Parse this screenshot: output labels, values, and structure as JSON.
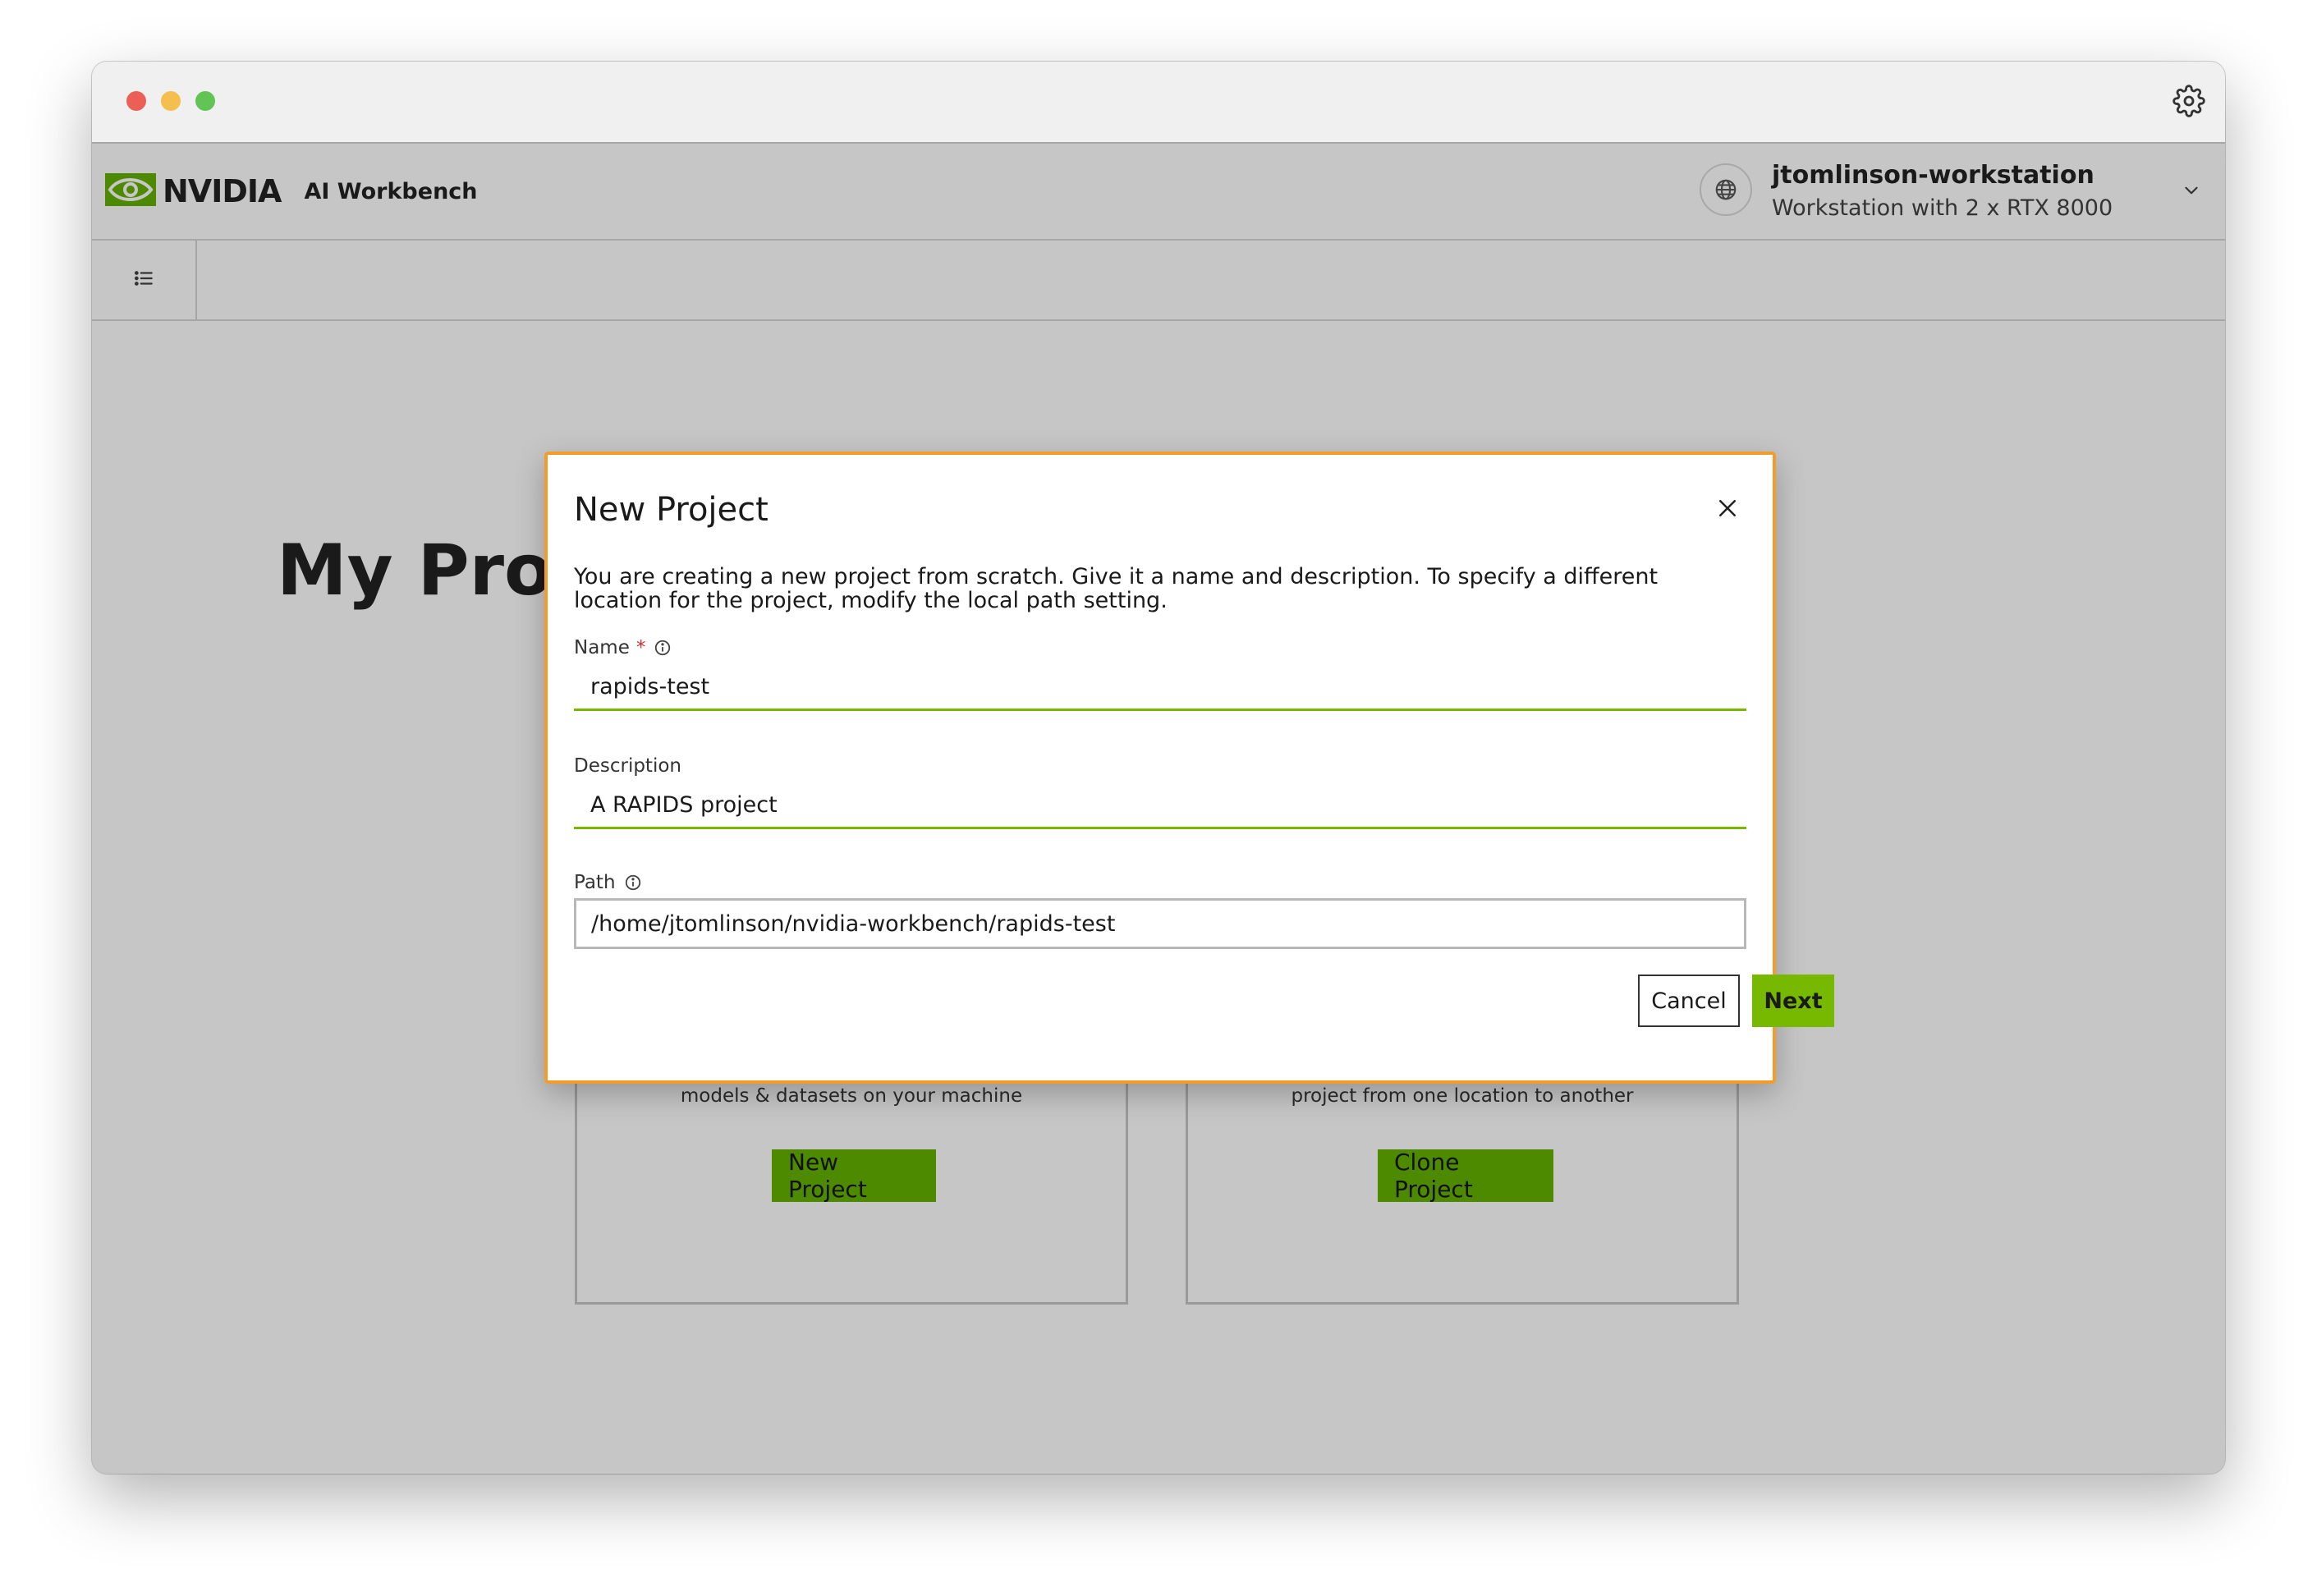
{
  "window": {
    "traffic_lights": {
      "close": "#ec5f57",
      "minimize": "#f4bf4f",
      "zoom": "#61c454"
    }
  },
  "header": {
    "brand": "NVIDIA",
    "app_name": "AI Workbench",
    "location": {
      "name": "jtomlinson-workstation",
      "description": "Workstation with 2 x RTX 8000"
    }
  },
  "page": {
    "title": "My Proj",
    "cards": [
      {
        "text": "models & datasets on your machine",
        "button": "New Project"
      },
      {
        "text": "project from one location to another",
        "button": "Clone Project"
      }
    ]
  },
  "dialog": {
    "title": "New Project",
    "description": "You are creating a new project from scratch. Give it a name and description. To specify a different location for the project, modify the local path setting.",
    "fields": {
      "name": {
        "label": "Name",
        "required": "*",
        "value": "rapids-test"
      },
      "description": {
        "label": "Description",
        "value": "A RAPIDS project"
      },
      "path": {
        "label": "Path",
        "value": "/home/jtomlinson/nvidia-workbench/rapids-test"
      }
    },
    "buttons": {
      "cancel": "Cancel",
      "next": "Next"
    }
  },
  "colors": {
    "accent": "#76b900",
    "button_dark": "#4e8a00",
    "focus_border": "#f39c2a",
    "required": "#d32f2f",
    "backdrop": "#c6c6c6"
  },
  "icons": [
    "settings-gear-icon",
    "nvidia-logo-icon",
    "globe-icon",
    "chevron-down-icon",
    "list-icon",
    "close-icon",
    "info-icon"
  ]
}
